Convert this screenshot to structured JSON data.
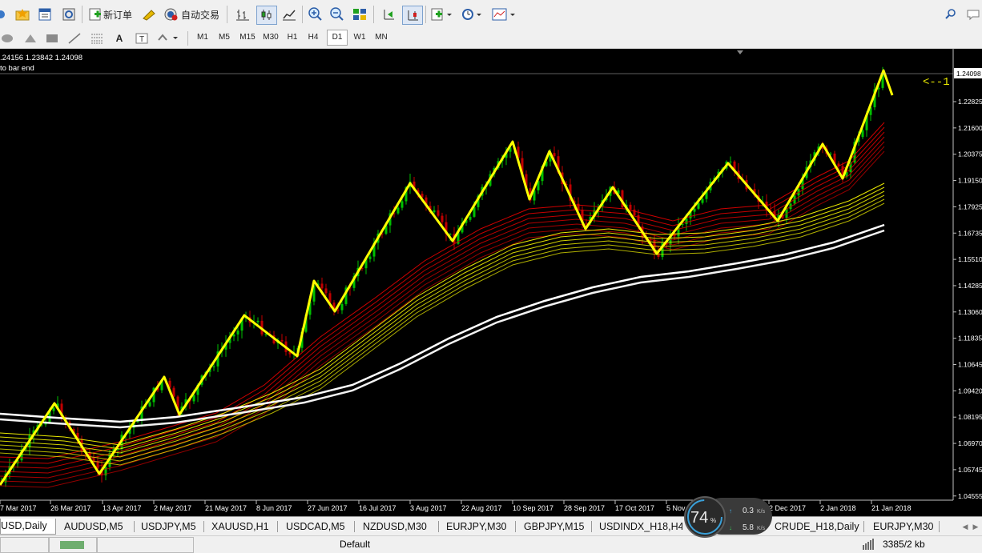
{
  "toolbar": {
    "new_order_label": "新订单",
    "auto_trading_label": "自动交易"
  },
  "timeframes": [
    "M1",
    "M5",
    "M15",
    "M30",
    "H1",
    "H4",
    "D1",
    "W1",
    "MN"
  ],
  "active_timeframe": "D1",
  "chart": {
    "ohlc_line": ".24156 1.23842 1.24098",
    "info_line": "to bar end",
    "current_price": "1.24098",
    "arrow_annotation": "<--1",
    "price_labels": [
      "1.22825",
      "1.21600",
      "1.20375",
      "1.19150",
      "1.17925",
      "1.16735",
      "1.15510",
      "1.14285",
      "1.13060",
      "1.11835",
      "1.10645",
      "1.09420",
      "1.08195",
      "1.06970",
      "1.05745",
      "1.04555"
    ],
    "date_labels": [
      "7 Mar 2017",
      "26 Mar 2017",
      "13 Apr 2017",
      "2 May 2017",
      "21 May 2017",
      "8 Jun 2017",
      "27 Jun 2017",
      "16 Jul 2017",
      "3 Aug 2017",
      "22 Aug 2017",
      "10 Sep 2017",
      "28 Sep 2017",
      "17 Oct 2017",
      "5 Nov 2017",
      "2 Dec 2017",
      "2 Jan 2018",
      "21 Jan 2018"
    ]
  },
  "tabs": [
    "USD,Daily",
    "AUDUSD,M5",
    "USDJPY,M5",
    "XAUUSD,H1",
    "USDCAD,M5",
    "NZDUSD,M30",
    "EURJPY,M30",
    "GBPJPY,M15",
    "USDINDX_H18,H4",
    "CRUDE_H18,Daily",
    "EURJPY,M30"
  ],
  "active_tab": "USD,Daily",
  "status": {
    "profile": "Default",
    "traffic": "3385/2 kb"
  },
  "net_widget": {
    "percent": "74",
    "percent_sign": "%",
    "upload": "0.3",
    "download": "5.8",
    "unit": "K/s"
  },
  "colors": {
    "chart_bg": "#000000",
    "zigzag": "#ffff00",
    "candle_up": "#00c000",
    "candle_down": "#c00000",
    "ma_fast": "#d00000",
    "ma_mid": "#e8e800",
    "ma_slow": "#ffffff"
  }
}
